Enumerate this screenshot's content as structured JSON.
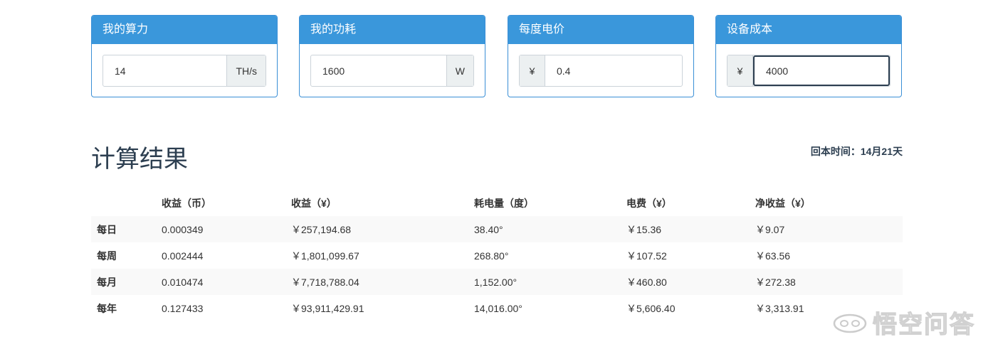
{
  "cards": [
    {
      "title": "我的算力",
      "value": "14",
      "suffix": "TH/s"
    },
    {
      "title": "我的功耗",
      "value": "1600",
      "suffix": "W"
    },
    {
      "title": "每度电价",
      "value": "0.4",
      "prefix": "¥"
    },
    {
      "title": "设备成本",
      "value": "4000",
      "prefix": "¥"
    }
  ],
  "result": {
    "title": "计算结果",
    "payback": "回本时间：14月21天"
  },
  "table": {
    "headers": [
      "",
      "收益（币）",
      "收益（¥）",
      "耗电量（度）",
      "电费（¥）",
      "净收益（¥）"
    ],
    "rows": [
      [
        "每日",
        "0.000349",
        "￥257,194.68",
        "38.40°",
        "￥15.36",
        "￥9.07"
      ],
      [
        "每周",
        "0.002444",
        "￥1,801,099.67",
        "268.80°",
        "￥107.52",
        "￥63.56"
      ],
      [
        "每月",
        "0.010474",
        "￥7,718,788.04",
        "1,152.00°",
        "￥460.80",
        "￥272.38"
      ],
      [
        "每年",
        "0.127433",
        "￥93,911,429.91",
        "14,016.00°",
        "￥5,606.40",
        "￥3,313.91"
      ]
    ]
  },
  "watermark": {
    "text": "悟空问答",
    "icon": "wukong-logo-icon"
  },
  "colors": {
    "header_blue": "#3a97db",
    "border_blue": "#3a8fd6",
    "focus_border": "#2c3e50"
  }
}
